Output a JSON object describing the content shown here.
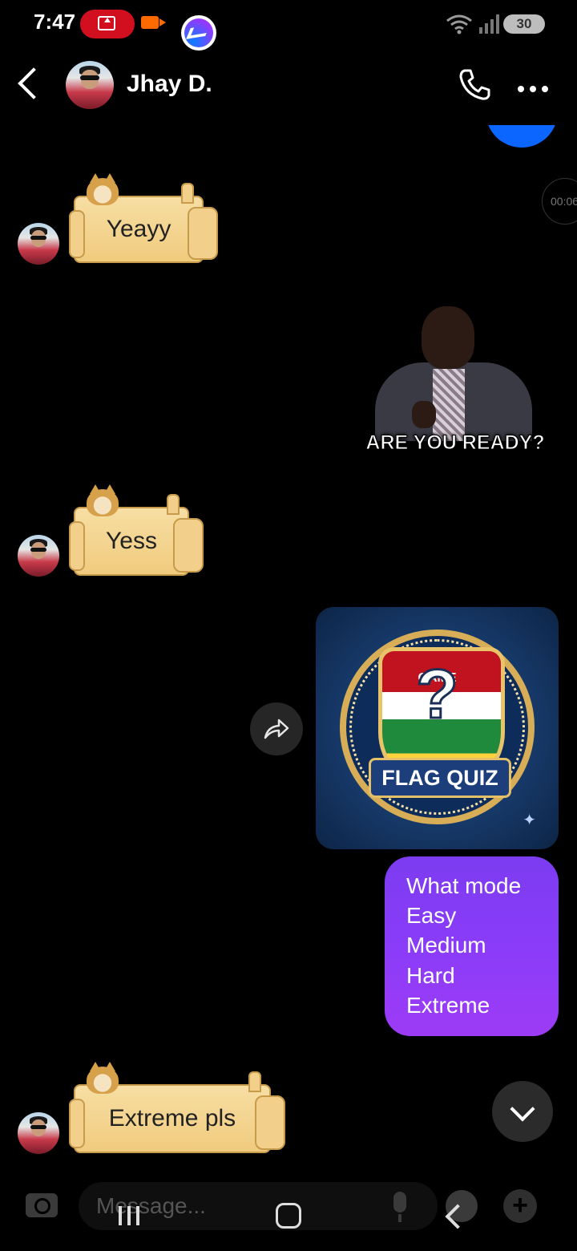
{
  "status_bar": {
    "time": "7:47",
    "battery": "30",
    "icons": [
      "screen-record-icon",
      "video-camera-icon",
      "messenger-icon",
      "wifi-icon",
      "signal-icon",
      "battery-icon"
    ]
  },
  "header": {
    "contact_name": "Jhay D.",
    "icons": [
      "back-icon",
      "avatar",
      "phone-icon",
      "more-icon"
    ]
  },
  "side_timer": "00:06",
  "messages": [
    {
      "from": "contact",
      "kind": "sticker",
      "text": "Yeayy"
    },
    {
      "from": "me",
      "kind": "gif",
      "caption": "ARE YOU READY?"
    },
    {
      "from": "contact",
      "kind": "sticker",
      "text": "Yess"
    },
    {
      "from": "me",
      "kind": "image",
      "image_text": {
        "top": "GAME",
        "title": "FLAG QUIZ",
        "symbol": "?"
      }
    },
    {
      "from": "me",
      "kind": "text",
      "lines": [
        "What mode",
        "Easy",
        "Medium",
        "Hard",
        "Extreme"
      ]
    },
    {
      "from": "contact",
      "kind": "sticker",
      "text": "Extreme pls"
    }
  ],
  "composer": {
    "placeholder": "Message..."
  },
  "colors": {
    "background": "#000000",
    "purple_bubble_top": "#7c3cf0",
    "purple_bubble_bottom": "#9d3bf6",
    "blue_bubble": "#0b66ff"
  }
}
